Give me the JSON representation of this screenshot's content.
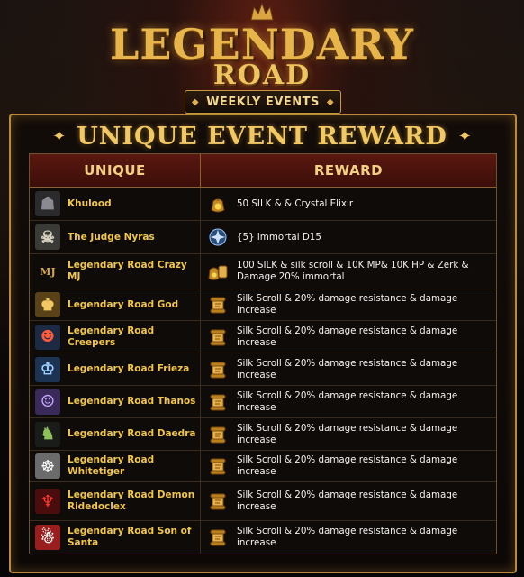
{
  "header": {
    "logo_line1": "LEGENDARY",
    "logo_line2": "ROAD",
    "weekly_label": "WEEKLY EVENTS"
  },
  "panel": {
    "title": "UNIQUE EVENT REWARD"
  },
  "table": {
    "columns": [
      "UNIQUE",
      "REWARD"
    ],
    "rows": [
      {
        "unique": "Khulood",
        "reward": "50 SILK & & Crystal Elixir",
        "icon": "silk-bag-icon",
        "avatar": "hooded-figure"
      },
      {
        "unique": "The Judge Nyras",
        "reward": "{5} immortal D15",
        "icon": "immortal-orb-icon",
        "avatar": "skull-knight"
      },
      {
        "unique": "Legendary Road Crazy MJ",
        "reward": "100 SILK & silk scroll & 10K MP& 10K HP & Zerk & Damage 20% immortal",
        "icon": "silk-bag-scroll-icon",
        "avatar": "mj-logo"
      },
      {
        "unique": "Legendary Road God",
        "reward": "Silk Scroll & 20% damage resistance & damage increase",
        "icon": "silk-scroll-icon",
        "avatar": "golden-god"
      },
      {
        "unique": "Legendary Road Creepers",
        "reward": "Silk Scroll & 20% damage resistance & damage increase",
        "icon": "silk-scroll-icon",
        "avatar": "creeper-beast"
      },
      {
        "unique": "Legendary Road Frieza",
        "reward": "Silk Scroll & 20% damage resistance & damage increase",
        "icon": "silk-scroll-icon",
        "avatar": "frieza"
      },
      {
        "unique": "Legendary Road Thanos",
        "reward": "Silk Scroll & 20% damage resistance & damage increase",
        "icon": "silk-scroll-icon",
        "avatar": "thanos"
      },
      {
        "unique": "Legendary Road Daedra",
        "reward": "Silk Scroll & 20% damage resistance & damage increase",
        "icon": "silk-scroll-icon",
        "avatar": "daedra"
      },
      {
        "unique": "Legendary Road Whitetiger",
        "reward": "Silk Scroll & 20% damage resistance & damage increase",
        "icon": "silk-scroll-icon",
        "avatar": "white-tiger"
      },
      {
        "unique": "Legendary Road Demon Ridedoclex",
        "reward": "Silk Scroll & 20% damage resistance & damage increase",
        "icon": "silk-scroll-icon",
        "avatar": "red-demon"
      },
      {
        "unique": "Legendary Road Son of Santa",
        "reward": "Silk Scroll & 20% damage resistance & damage increase",
        "icon": "silk-scroll-icon",
        "avatar": "santa"
      }
    ]
  },
  "colors": {
    "gold": "#f0c64c",
    "header_red": "#5a1810",
    "border": "#b98a3a"
  }
}
